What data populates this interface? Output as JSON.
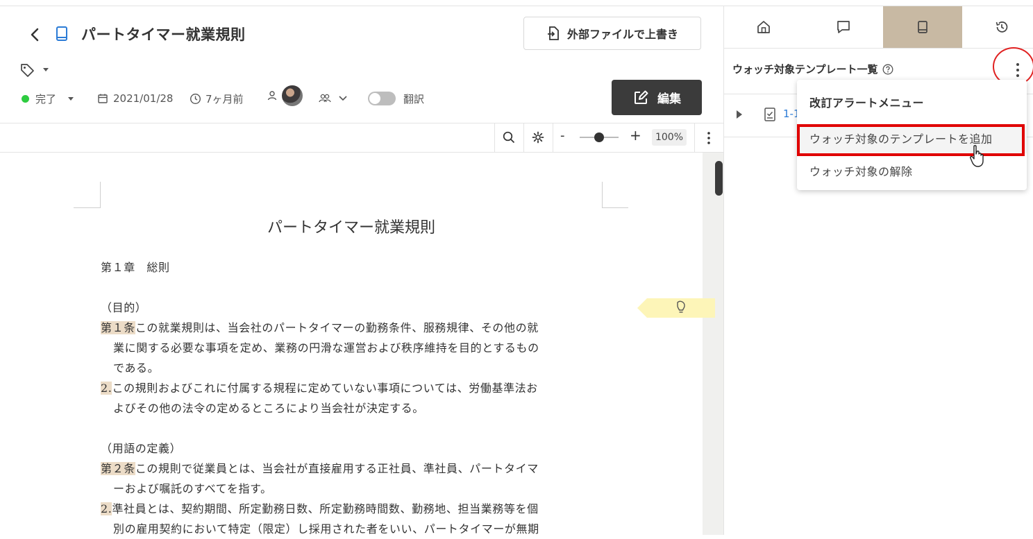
{
  "header": {
    "title": "パートタイマー就業規則",
    "overwrite_button": "外部ファイルで上書き",
    "edit_button": "編集"
  },
  "meta": {
    "status": "完了",
    "date": "2021/01/28",
    "relative_time": "7ヶ月前",
    "translate_label": "翻訳"
  },
  "viewer_toolbar": {
    "zoom_minus": "-",
    "zoom_plus": "+",
    "zoom_level": "100%",
    "zoom_fraction": 0.5
  },
  "document": {
    "heading": "パートタイマー就業規則",
    "lines": [
      {
        "prefix": "",
        "text": "第１章　総則",
        "indent": false
      },
      {
        "prefix": "",
        "text": "",
        "indent": false
      },
      {
        "prefix": "",
        "text": "（目的）",
        "indent": false
      },
      {
        "prefix": "第１条",
        "text": "この就業規則は、当会社のパートタイマーの勤務条件、服務規律、その他の就",
        "indent": false
      },
      {
        "prefix": "",
        "text": "業に関する必要な事項を定め、業務の円滑な運営および秩序維持を目的とするもの",
        "indent": true
      },
      {
        "prefix": "",
        "text": "である。",
        "indent": true
      },
      {
        "prefix": "2.",
        "text": "この規則およびこれに付属する規程に定めていない事項については、労働基準法お",
        "indent": false
      },
      {
        "prefix": "",
        "text": "よびその他の法令の定めるところにより当会社が決定する。",
        "indent": true
      },
      {
        "prefix": "",
        "text": "",
        "indent": false
      },
      {
        "prefix": "",
        "text": "（用語の定義）",
        "indent": false
      },
      {
        "prefix": "第２条",
        "text": "この規則で従業員とは、当会社が直接雇用する正社員、準社員、パートタイマ",
        "indent": false
      },
      {
        "prefix": "",
        "text": "ーおよび嘱託のすべてを指す。",
        "indent": true
      },
      {
        "prefix": "2.",
        "text": "準社員とは、契約期間、所定勤務日数、所定勤務時間数、勤務地、担当業務等を個",
        "indent": false
      },
      {
        "prefix": "",
        "text": "別の雇用契約において特定（限定）し採用された者をいい、パートタイマーが無期",
        "indent": true
      }
    ]
  },
  "right_panel": {
    "tabs": [
      {
        "name": "home-tab",
        "icon": "home-icon",
        "active": false
      },
      {
        "name": "comment-tab",
        "icon": "comment-icon",
        "active": false
      },
      {
        "name": "book-tab",
        "icon": "book-icon",
        "active": true
      },
      {
        "name": "history-tab",
        "icon": "history-icon",
        "active": false
      }
    ],
    "title": "ウォッチ対象テンプレート一覧",
    "tree_item_label": "1-1",
    "menu": {
      "header": "改訂アラートメニュー",
      "items": [
        "ウォッチ対象のテンプレートを追加",
        "ウォッチ対象の解除"
      ]
    }
  },
  "colors": {
    "status_green": "#2ecc40",
    "active_tab": "#c8b9a3",
    "highlight": "#ecdcc7",
    "annotation_red": "#e00000",
    "link_blue": "#2b7bd6"
  }
}
